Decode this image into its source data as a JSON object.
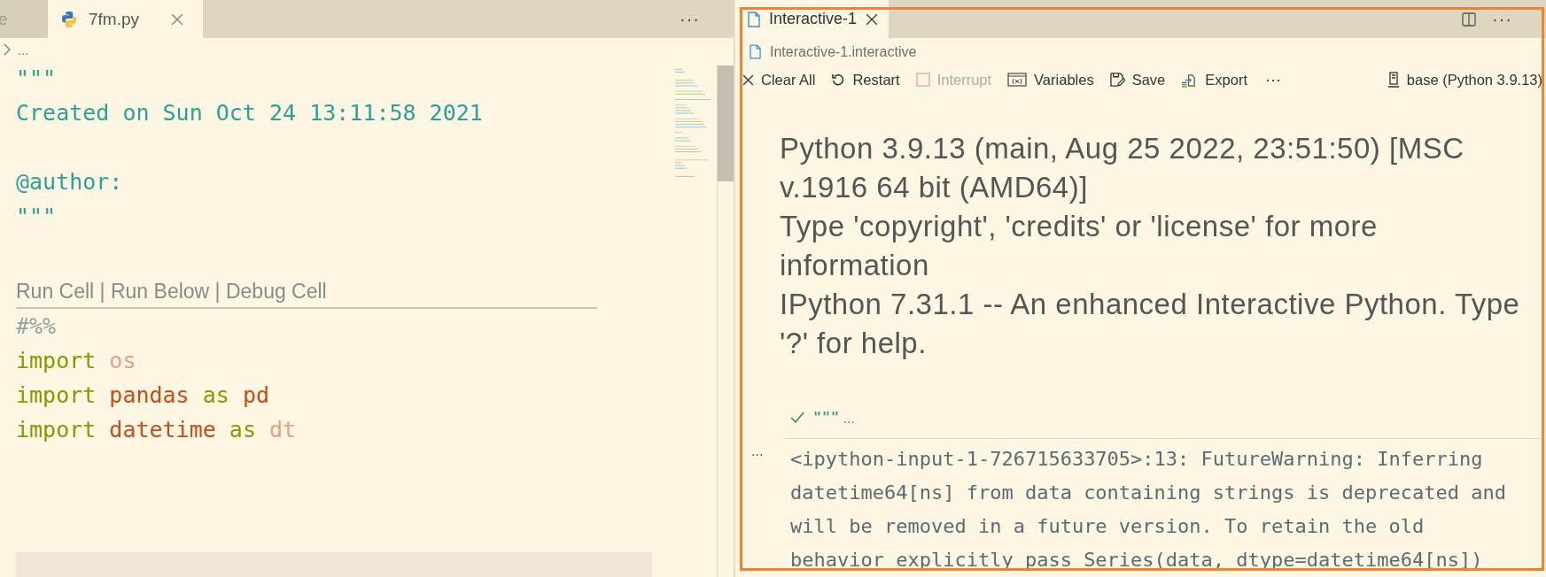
{
  "left_editor": {
    "tabs": [
      {
        "label": "e",
        "selected": false,
        "kind": "plain"
      },
      {
        "label": "7fm.py",
        "selected": true,
        "kind": "python"
      }
    ],
    "more": "···",
    "breadcrumb": "...",
    "blocks_before": [
      {
        "lines": [
          {
            "tokens": [
              {
                "kind": "string",
                "text": "\"\"\""
              }
            ]
          },
          {
            "tokens": [
              {
                "kind": "string",
                "text": "Created on Sun Oct 24 13:11:58 2021"
              }
            ]
          }
        ]
      },
      {
        "lines": [
          {
            "tokens": [
              {
                "kind": "string",
                "text": "@author:"
              }
            ]
          },
          {
            "tokens": [
              {
                "kind": "string",
                "text": "\"\"\""
              }
            ]
          }
        ]
      }
    ],
    "codelens": "Run Cell | Run Below | Debug Cell",
    "lines_after": [
      {
        "tokens": [
          {
            "kind": "comment",
            "text": "#%%"
          }
        ]
      },
      {
        "tokens": [
          {
            "kind": "keyword",
            "text": "import"
          },
          {
            "kind": "light",
            "text": "os"
          }
        ]
      },
      {
        "tokens": [
          {
            "kind": "keyword",
            "text": "import"
          },
          {
            "kind": "module",
            "text": "pandas"
          },
          {
            "kind": "keyword",
            "text": "as"
          },
          {
            "kind": "module",
            "text": "pd"
          }
        ]
      },
      {
        "tokens": [
          {
            "kind": "keyword",
            "text": "import"
          },
          {
            "kind": "module",
            "text": "datetime"
          },
          {
            "kind": "keyword",
            "text": "as"
          },
          {
            "kind": "light",
            "text": "dt"
          }
        ]
      }
    ]
  },
  "interactive": {
    "tab": {
      "label": "Interactive-1",
      "selected": true
    },
    "more": "···",
    "breadcrumb": "Interactive-1.interactive",
    "toolbar": [
      {
        "kind": "clear",
        "label": "Clear All",
        "disabled": false
      },
      {
        "kind": "restart",
        "label": "Restart",
        "disabled": false
      },
      {
        "kind": "interrupt",
        "label": "Interrupt",
        "disabled": true
      },
      {
        "kind": "variables",
        "label": "Variables",
        "disabled": false
      },
      {
        "kind": "save",
        "label": "Save",
        "disabled": false
      },
      {
        "kind": "export",
        "label": "Export",
        "disabled": false
      }
    ],
    "toolbar_more": "···",
    "kernel": "base (Python 3.9.13)",
    "banner": [
      "Python 3.9.13 (main, Aug 25 2022, 23:51:50) [MSC v.1916 64 bit (AMD64)]",
      "Type 'copyright', 'credits' or 'license' for more information",
      "IPython 7.31.1 -- An enhanced Interactive Python. Type '?' for help."
    ],
    "cell": {
      "succeeded": true,
      "code": "\"\"\"",
      "ellipsis": "..."
    },
    "output_gutter": "...",
    "warning": "<ipython-input-1-726715633705>:13: FutureWarning: Inferring datetime64[ns] from data containing strings is deprecated and will be removed in a future version. To retain the old behavior explicitly pass Series(data, dtype=datetime64[ns])"
  }
}
